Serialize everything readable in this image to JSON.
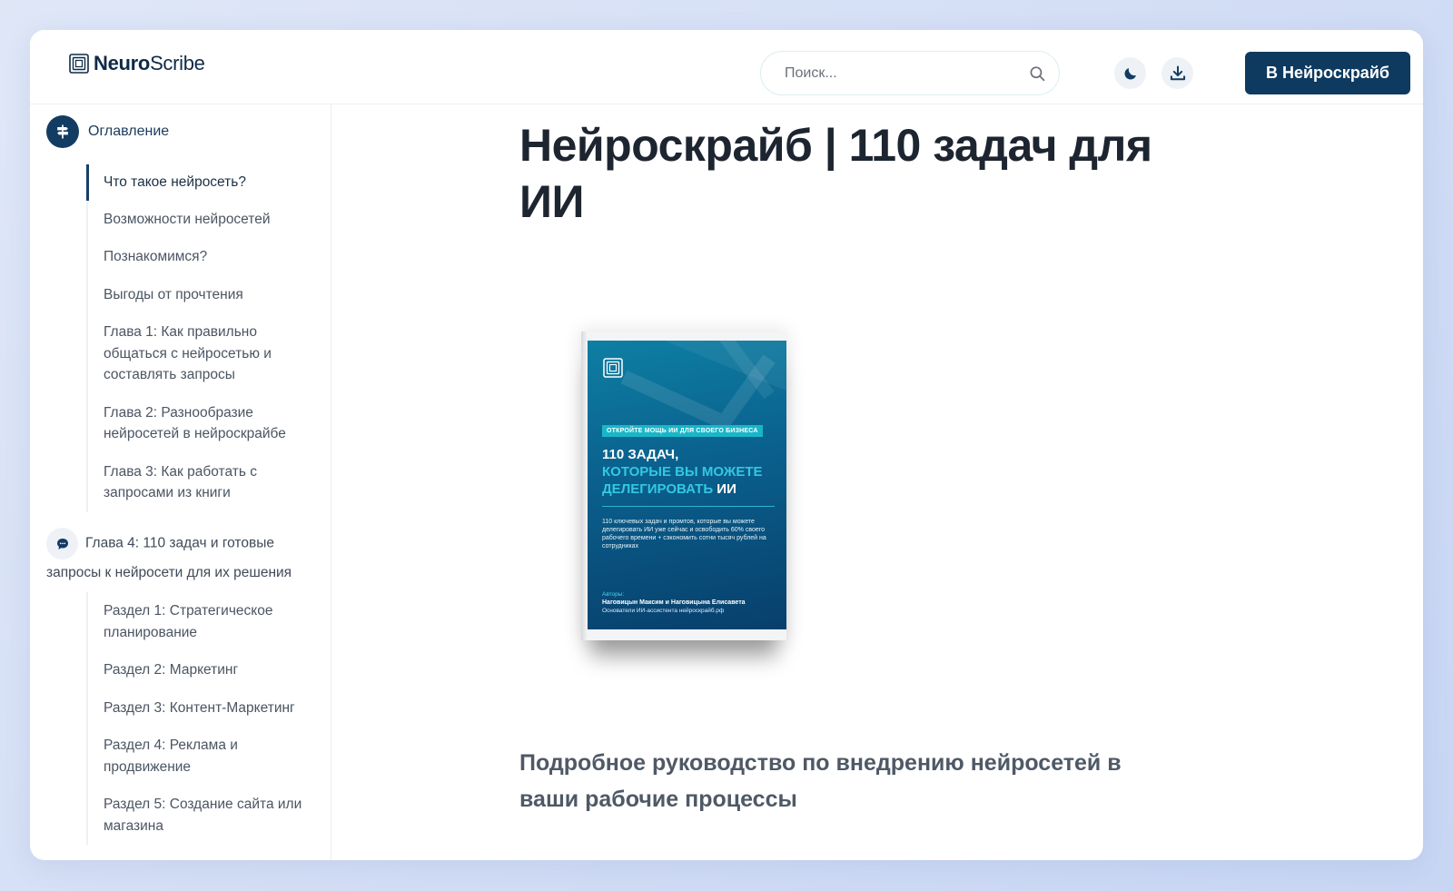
{
  "header": {
    "logo_bold": "Neuro",
    "logo_light": "Scribe",
    "search_placeholder": "Поиск...",
    "cta_label": "В Нейроскрайб",
    "icons": [
      "moon-icon",
      "download-icon",
      "search-icon"
    ]
  },
  "sidebar": {
    "toc_title": "Оглавление",
    "items": [
      {
        "label": "Что такое нейросеть?",
        "active": true
      },
      {
        "label": "Возможности нейросетей"
      },
      {
        "label": "Познакомимся?"
      },
      {
        "label": "Выгоды от прочтения"
      },
      {
        "label": "Глава 1: Как правильно общаться с нейросетью и составлять запросы"
      },
      {
        "label": "Глава 2: Разнообразие нейросетей в нейроскрайбе"
      },
      {
        "label": "Глава 3: Как работать с запросами из книги"
      }
    ],
    "chapter4": "Глава 4: 110 задач и готовые запросы к нейросети для их решения",
    "sections": [
      {
        "label": "Раздел 1: Стратегическое планирование"
      },
      {
        "label": "Раздел 2: Маркетинг"
      },
      {
        "label": "Раздел 3: Контент-Маркетинг"
      },
      {
        "label": "Раздел 4: Реклама и продвижение"
      },
      {
        "label": "Раздел 5: Создание сайта или магазина"
      }
    ]
  },
  "main": {
    "title": "Нейроскрайб | 110 задач для ИИ",
    "cover": {
      "badge": "ОТКРОЙТЕ МОЩЬ ИИ ДЛЯ СВОЕГО БИЗНЕСА",
      "heading_white": "110 ЗАДАЧ,",
      "heading_cyan": "КОТОРЫЕ ВЫ МОЖЕТЕ ДЕЛЕГИРОВАТЬ",
      "heading_tail": "ИИ",
      "description": "110 ключевых задач и промтов, которые вы можете делегировать ИИ уже сейчас и освободить 60% своего рабочего времени + сэкономить сотни тысяч рублей на сотрудниках",
      "authors_label": "Авторы:",
      "authors": "Наговицын Максим и Наговицына Елисавета",
      "founders": "Основатели ИИ-ассистента нейроскрайб.рф"
    },
    "subtitle": "Подробное руководство по внедрению нейросетей в ваши рабочие процессы"
  },
  "colors": {
    "accent": "#0e3a5f",
    "text_dark": "#1d2530",
    "cover_teal": "#0a5f8c",
    "cover_cyan": "#33c8e2"
  }
}
